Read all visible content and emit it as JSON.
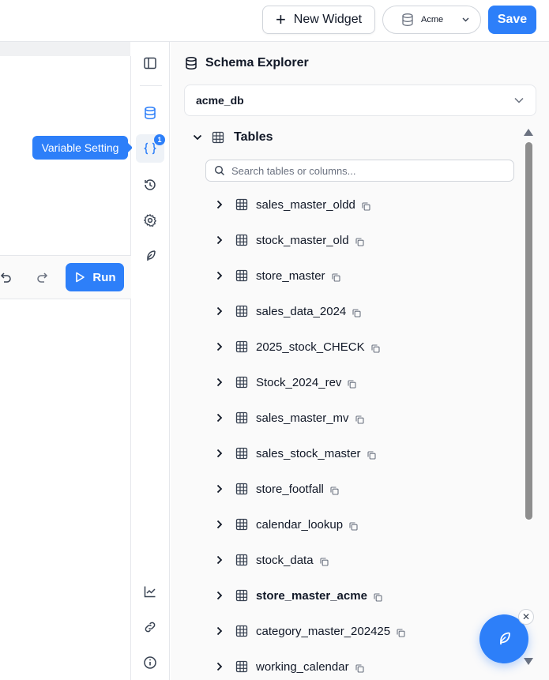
{
  "toolbar": {
    "new_widget_label": "New Widget",
    "database_selector_value": "Acme",
    "save_label": "Save"
  },
  "editor": {
    "run_label": "Run"
  },
  "tooltip": {
    "text": "Variable Setting"
  },
  "rail": {
    "icons": [
      "panel-toggle-icon",
      "database-icon",
      "variable-braces-icon",
      "history-icon",
      "settings-gear-icon",
      "feather-icon",
      "chart-icon",
      "link-icon",
      "info-icon"
    ],
    "variable_badge": "1"
  },
  "schema_explorer": {
    "title": "Schema Explorer",
    "database": "acme_db",
    "section_label": "Tables",
    "search_placeholder": "Search tables or columns...",
    "tables": [
      {
        "name": "sales_master_oldd"
      },
      {
        "name": "stock_master_old"
      },
      {
        "name": "store_master"
      },
      {
        "name": "sales_data_2024"
      },
      {
        "name": "2025_stock_CHECK"
      },
      {
        "name": "Stock_2024_rev"
      },
      {
        "name": "sales_master_mv"
      },
      {
        "name": "sales_stock_master"
      },
      {
        "name": "store_footfall"
      },
      {
        "name": "calendar_lookup"
      },
      {
        "name": "stock_data"
      },
      {
        "name": "store_master_acme"
      },
      {
        "name": "category_master_202425"
      },
      {
        "name": "working_calendar"
      }
    ]
  },
  "colors": {
    "accent": "#2d7ff9",
    "border": "#e5e7eb",
    "panel_bg": "#fafafa"
  }
}
